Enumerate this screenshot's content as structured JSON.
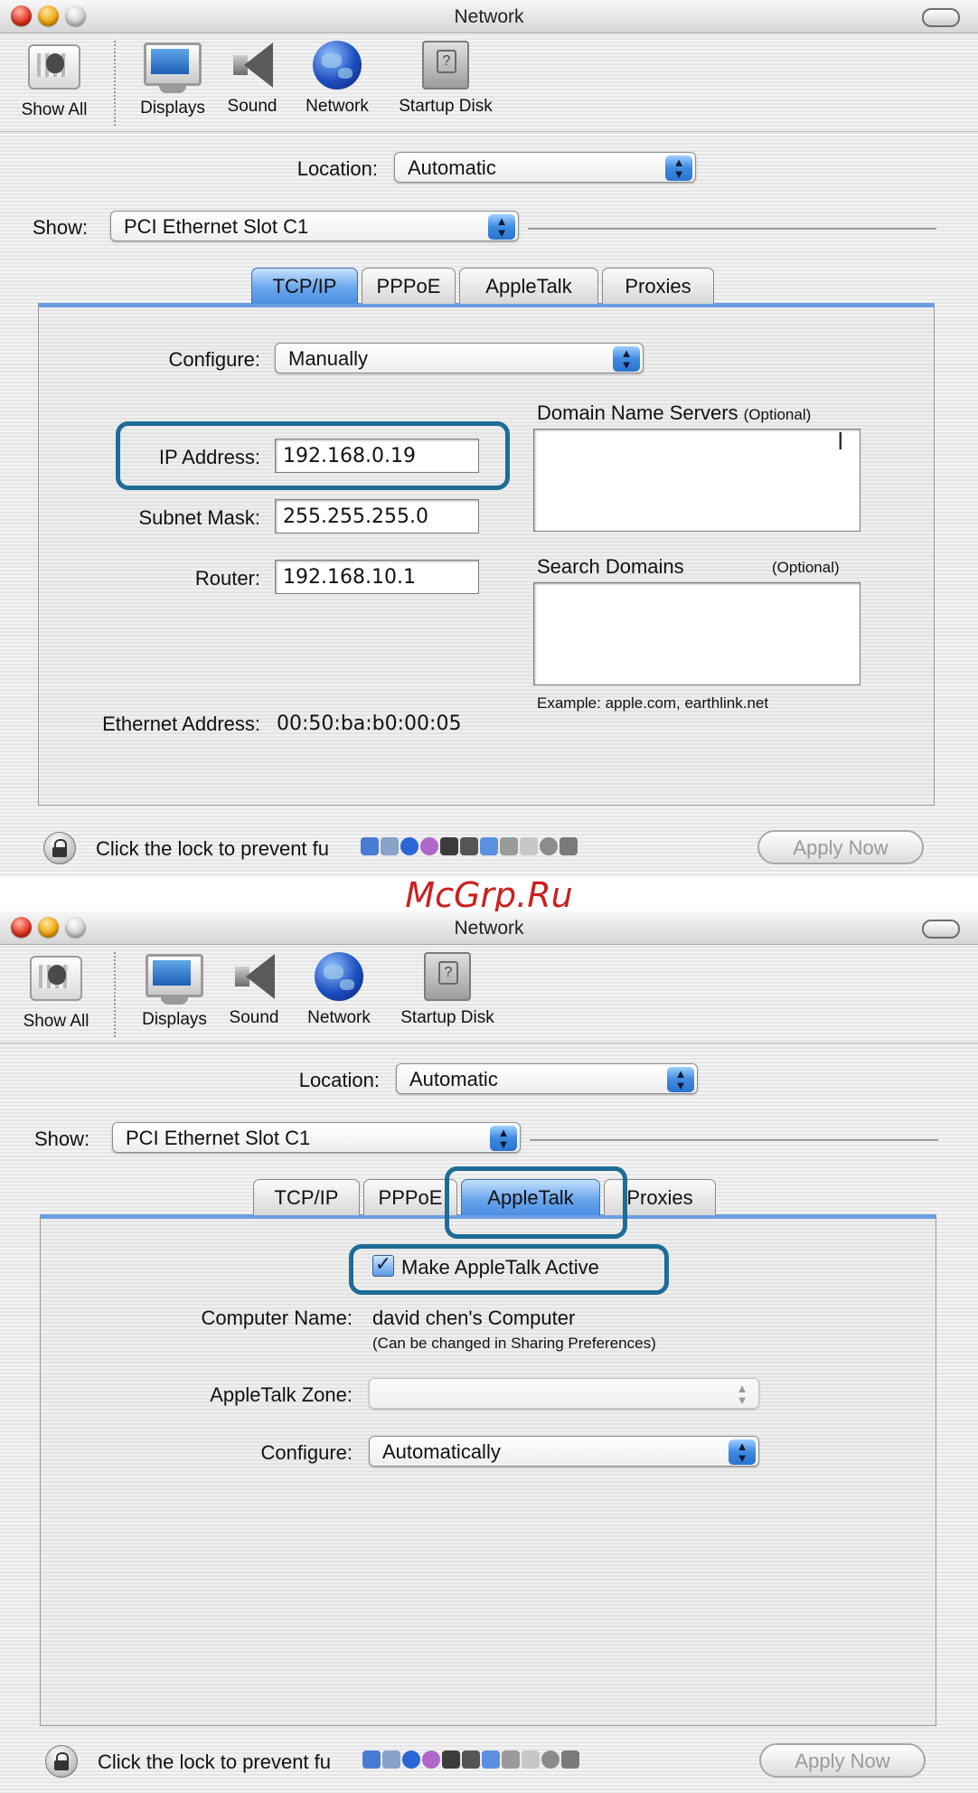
{
  "window": {
    "title": "Network"
  },
  "toolbar": {
    "show_all": "Show All",
    "displays": "Displays",
    "sound": "Sound",
    "network": "Network",
    "startup_disk": "Startup Disk"
  },
  "location": {
    "label": "Location:",
    "value": "Automatic"
  },
  "show": {
    "label": "Show:",
    "value": "PCI Ethernet Slot C1"
  },
  "tabs": [
    "TCP/IP",
    "PPPoE",
    "AppleTalk",
    "Proxies"
  ],
  "tcpip": {
    "configure_label": "Configure:",
    "configure_value": "Manually",
    "ip_label": "IP Address:",
    "ip_value": "192.168.0.19",
    "subnet_label": "Subnet Mask:",
    "subnet_value": "255.255.255.0",
    "router_label": "Router:",
    "router_value": "192.168.10.1",
    "dns_label": "Domain Name Servers",
    "dns_optional": "(Optional)",
    "search_label": "Search Domains",
    "search_optional": "(Optional)",
    "example": "Example: apple.com, earthlink.net",
    "ethernet_label": "Ethernet Address:",
    "ethernet_value": "00:50:ba:b0:00:05"
  },
  "appletalk": {
    "active_label": "Make AppleTalk Active",
    "active_checked": true,
    "computer_name_label": "Computer Name:",
    "computer_name_value": "david chen's Computer",
    "computer_name_note": "(Can be changed in Sharing Preferences)",
    "zone_label": "AppleTalk Zone:",
    "configure_label": "Configure:",
    "configure_value": "Automatically"
  },
  "footer": {
    "lock_text": "Click the lock to prevent further changes.",
    "lock_text_visible": "Click the lock to prevent fu",
    "apply_label": "Apply Now"
  },
  "watermark": "McGrp.Ru",
  "colors": {
    "highlight": "#1d6c96",
    "tab_active": "#6aa6ec",
    "watermark": "#cc1f1f"
  }
}
